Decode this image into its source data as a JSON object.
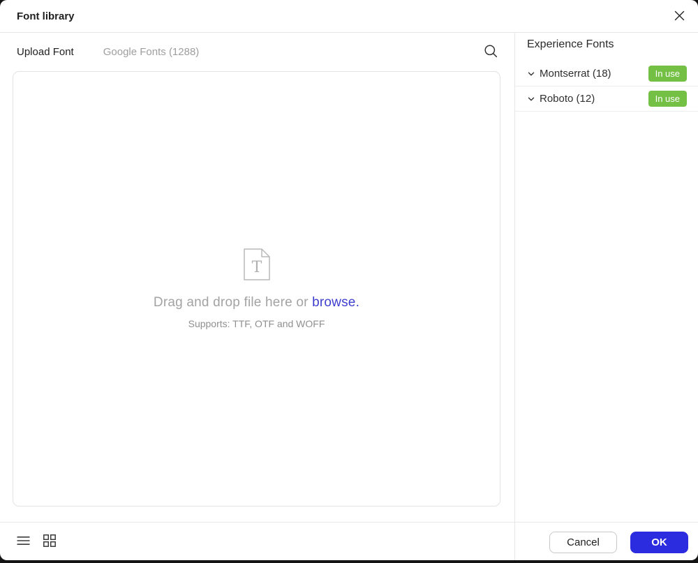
{
  "dialog": {
    "title": "Font library"
  },
  "tabs": [
    {
      "label": "Upload Font",
      "active": true
    },
    {
      "label": "Google Fonts (1288)",
      "active": false
    }
  ],
  "dropzone": {
    "drag_prefix": "Drag and drop file here or ",
    "browse_label": "browse",
    "suffix": ".",
    "supports": "Supports: TTF, OTF and WOFF",
    "file_icon_letter": "T"
  },
  "right_panel": {
    "header": "Experience Fonts",
    "fonts": [
      {
        "name": "Montserrat (18)",
        "badge": "In use"
      },
      {
        "name": "Roboto (12)",
        "badge": "In use"
      }
    ]
  },
  "footer": {
    "cancel_label": "Cancel",
    "ok_label": "OK"
  },
  "colors": {
    "accent_blue": "#2b2be0",
    "link_blue": "#4040d0",
    "badge_green": "#74c044"
  }
}
